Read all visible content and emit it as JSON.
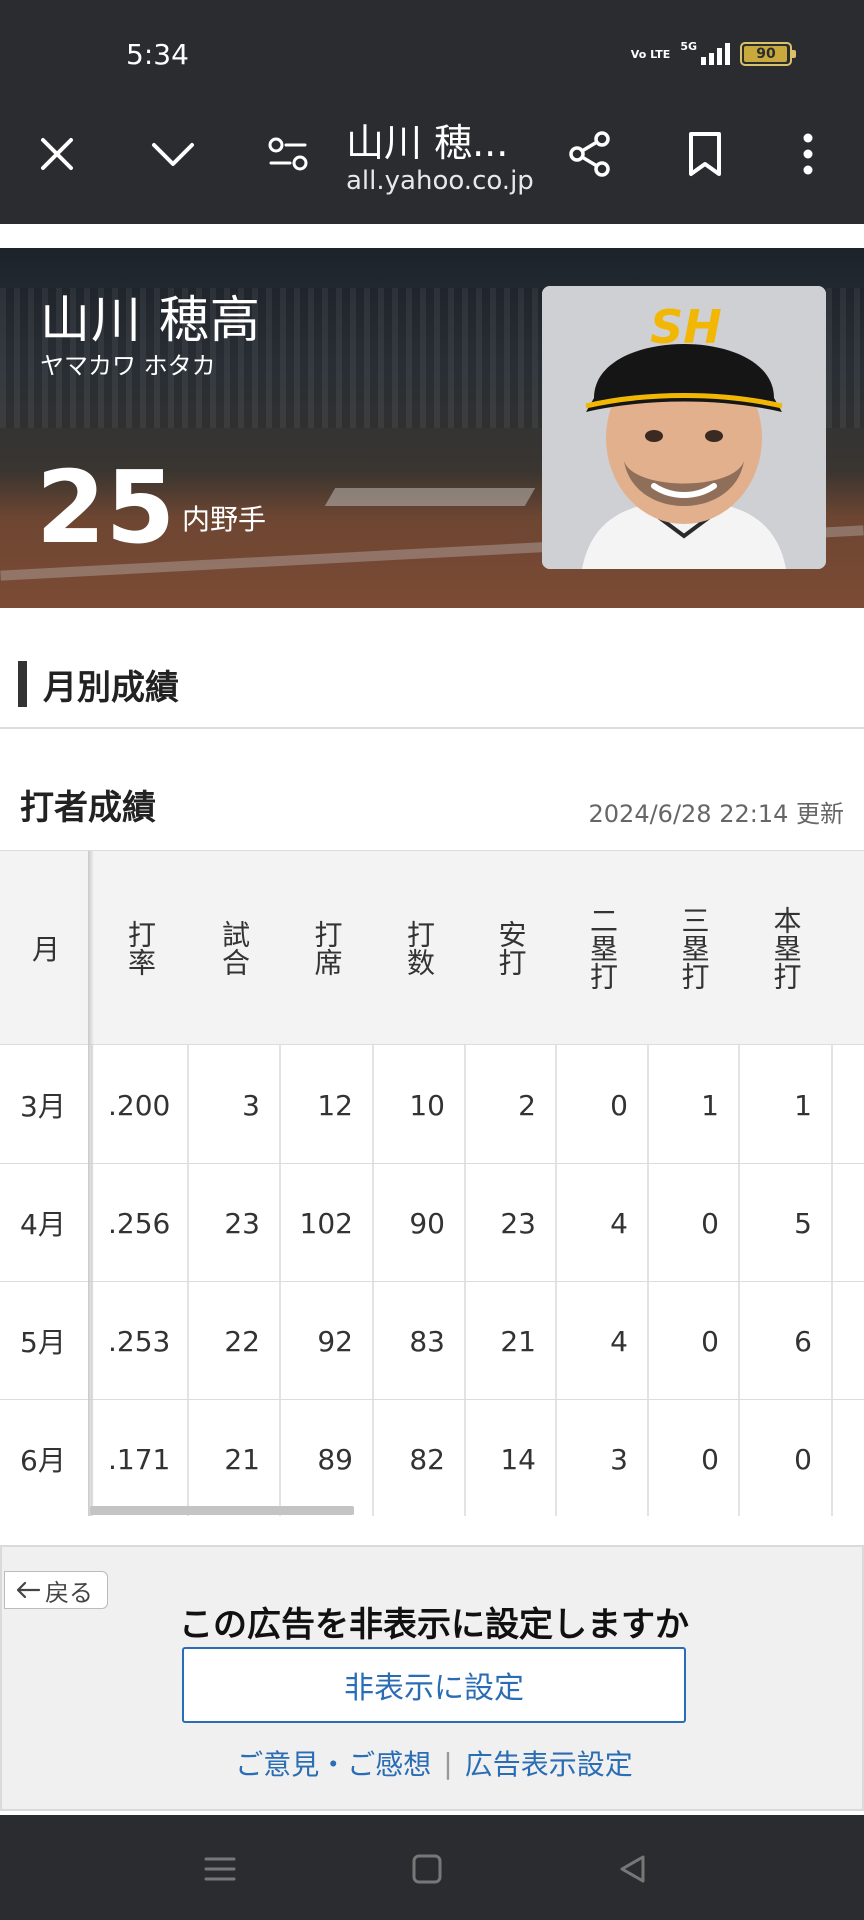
{
  "status_bar": {
    "time": "5:34",
    "volte": "Vo LTE",
    "network": "5G",
    "battery": "90",
    "battery_level": 0.9
  },
  "browser": {
    "page_title": "山川 穂...",
    "domain": "all.yahoo.co.jp",
    "icons": [
      "close-icon",
      "chevron-down-icon",
      "tune-icon",
      "share-icon",
      "bookmark-icon",
      "more-vert-icon"
    ]
  },
  "player": {
    "name": "山川 穂高",
    "kana": "ヤマカワ ホタカ",
    "number": "25",
    "position": "内野手",
    "cap_logo": "SH"
  },
  "section": {
    "title": "月別成績"
  },
  "batting": {
    "title": "打者成績",
    "updated": "2024/6/28 22:14 更新",
    "headers": [
      "月",
      "打率",
      "試合",
      "打席",
      "打数",
      "安打",
      "二塁打",
      "三塁打",
      "本塁打"
    ],
    "rows": [
      [
        "3月",
        ".200",
        "3",
        "12",
        "10",
        "2",
        "0",
        "1",
        "1"
      ],
      [
        "4月",
        ".256",
        "23",
        "102",
        "90",
        "23",
        "4",
        "0",
        "5"
      ],
      [
        "5月",
        ".253",
        "22",
        "92",
        "83",
        "21",
        "4",
        "0",
        "6"
      ],
      [
        "6月",
        ".171",
        "21",
        "89",
        "82",
        "14",
        "3",
        "0",
        "0"
      ]
    ]
  },
  "ad_prompt": {
    "back_label": "戻る",
    "question": "この広告を非表示に設定しますか",
    "hide_button": "非表示に設定",
    "feedback_link": "ご意見・ご感想",
    "separator": "|",
    "settings_link": "広告表示設定"
  },
  "colors": {
    "bar_bg": "#2b2c30",
    "link_blue": "#2a6db5",
    "team_gold": "#f2b705"
  }
}
